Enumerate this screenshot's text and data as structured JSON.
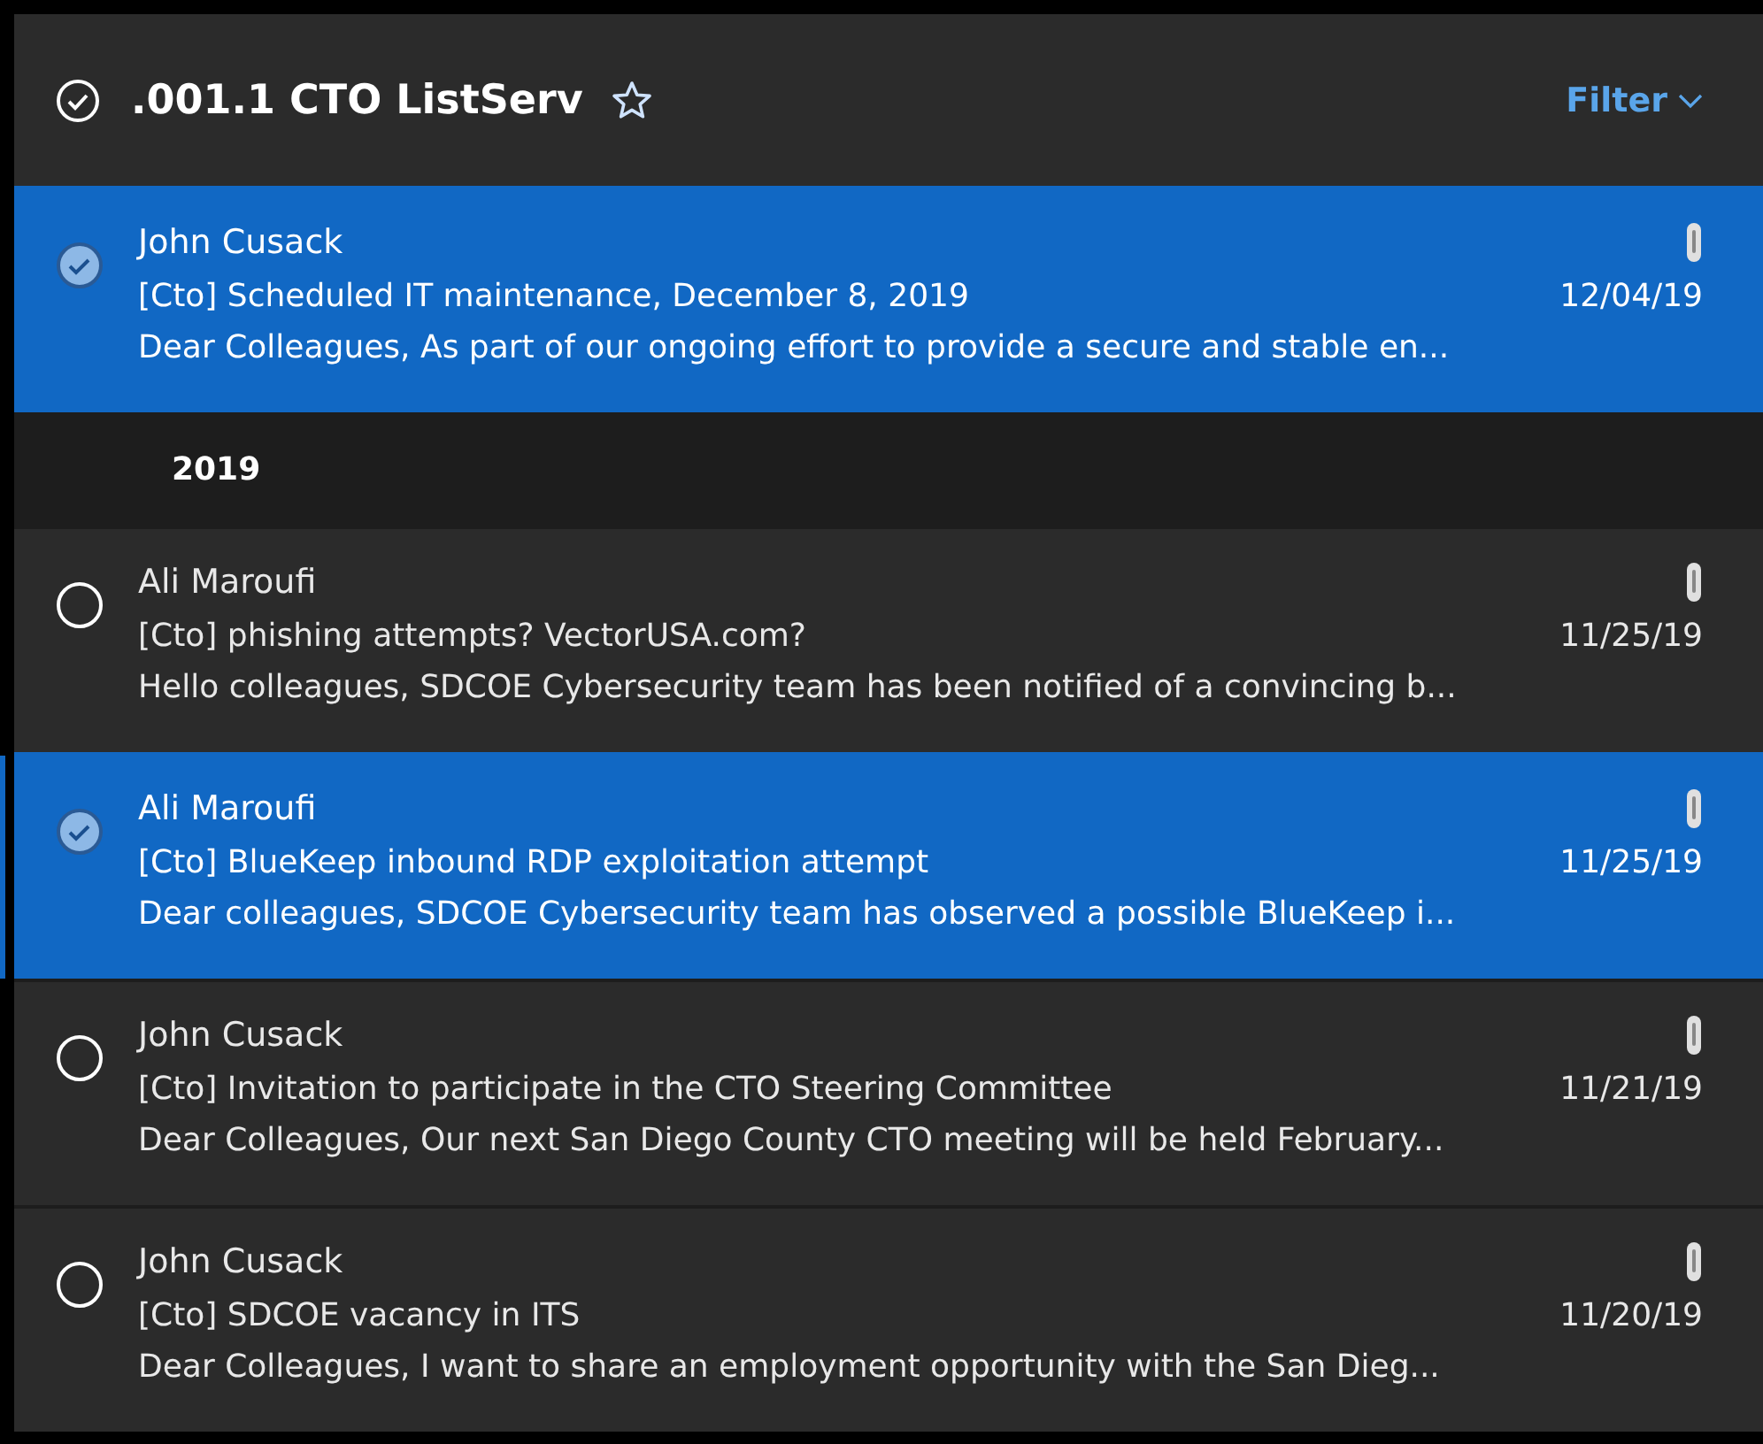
{
  "header": {
    "title": ".001.1 CTO ListServ",
    "favorite": false,
    "filter": {
      "label": "Filter"
    }
  },
  "messages": [
    {
      "sender": "John Cusack",
      "subject": "[Cto] Scheduled IT maintenance, December 8, 2019",
      "date": "12/04/19",
      "preview": "Dear Colleagues, As part of our ongoing effort to provide a secure and stable en...",
      "attachment": true,
      "selected": true,
      "focused": false
    }
  ],
  "groups": [
    {
      "label": "2019",
      "messages": [
        {
          "sender": "Ali Maroufi",
          "subject": "[Cto] phishing attempts? VectorUSA.com?",
          "date": "11/25/19",
          "preview": "Hello colleagues, SDCOE Cybersecurity team has been notified of a convincing b...",
          "attachment": true,
          "selected": false,
          "focused": false
        },
        {
          "sender": "Ali Maroufi",
          "subject": "[Cto] BlueKeep inbound RDP exploitation attempt",
          "date": "11/25/19",
          "preview": "Dear colleagues, SDCOE Cybersecurity team has observed a possible BlueKeep i...",
          "attachment": true,
          "selected": true,
          "focused": true
        },
        {
          "sender": "John Cusack",
          "subject": "[Cto] Invitation to participate in the CTO Steering Committee",
          "date": "11/21/19",
          "preview": "Dear Colleagues, Our next San Diego County CTO meeting will be held February...",
          "attachment": true,
          "selected": false,
          "focused": false
        },
        {
          "sender": "John Cusack",
          "subject": "[Cto] SDCOE vacancy in ITS",
          "date": "11/20/19",
          "preview": "Dear Colleagues, I want to share an employment opportunity with the San Dieg...",
          "attachment": true,
          "selected": false,
          "focused": false
        }
      ]
    }
  ]
}
